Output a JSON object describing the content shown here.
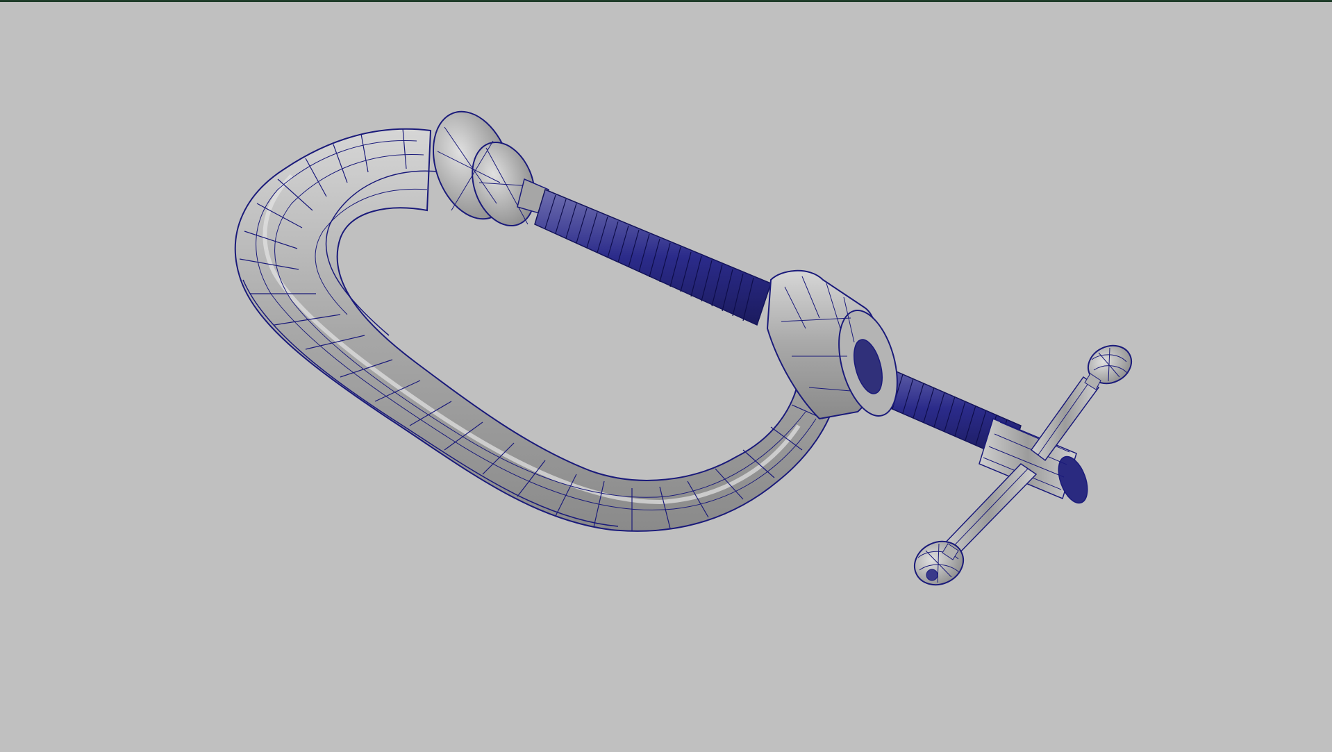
{
  "viewport": {
    "background_color": "#c0c0c0",
    "active_border_color": "#1f3d2a",
    "display_mode": "wireframe-on-shaded",
    "selection_state": "none"
  },
  "model": {
    "object": "c-clamp",
    "shaded_color": "#a9a9a9",
    "highlight_color": "#dcdcdc",
    "shadow_color": "#7a7a7a",
    "wireframe_color": "#1a1a7a",
    "parts": [
      "frame",
      "swivel-pad",
      "screw",
      "boss",
      "t-handle",
      "handle-knob-top",
      "handle-knob-bottom"
    ]
  }
}
